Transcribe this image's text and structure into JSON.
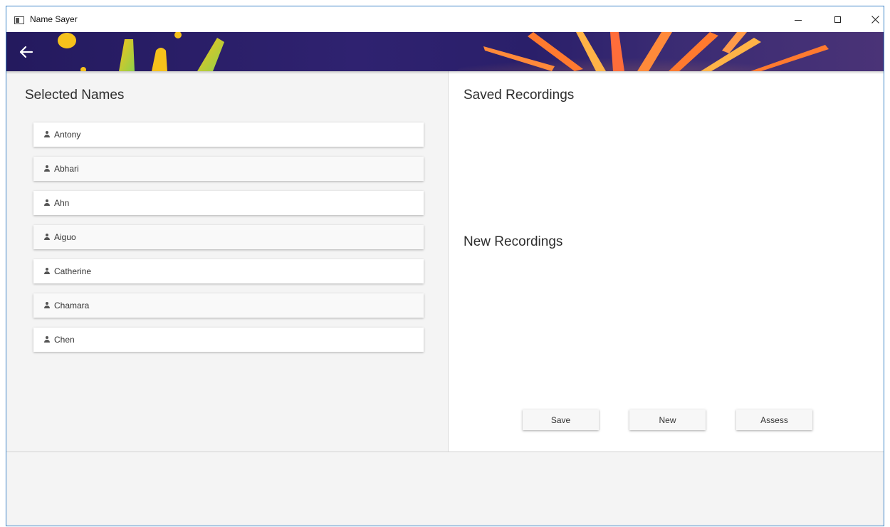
{
  "window": {
    "title": "Name Sayer",
    "controls": [
      "minimize-icon",
      "maximize-icon",
      "close-icon"
    ]
  },
  "banner": {
    "back_icon": "arrow-left-icon",
    "colors": {
      "background": "#241a5e",
      "yellow": "#f6c21b",
      "green": "#8fd14a",
      "orange": "#ff7a2f"
    }
  },
  "selected_names": {
    "heading": "Selected Names",
    "items": [
      {
        "label": "Antony",
        "icon": "person-icon"
      },
      {
        "label": "Abhari",
        "icon": "person-icon"
      },
      {
        "label": "Ahn",
        "icon": "person-icon"
      },
      {
        "label": "Aiguo",
        "icon": "person-icon"
      },
      {
        "label": "Catherine",
        "icon": "person-icon"
      },
      {
        "label": "Chamara",
        "icon": "person-icon"
      },
      {
        "label": "Chen",
        "icon": "person-icon"
      }
    ]
  },
  "recordings": {
    "saved_heading": "Saved Recordings",
    "new_heading": "New Recordings"
  },
  "actions": {
    "save_label": "Save",
    "new_label": "New",
    "assess_label": "Assess"
  }
}
